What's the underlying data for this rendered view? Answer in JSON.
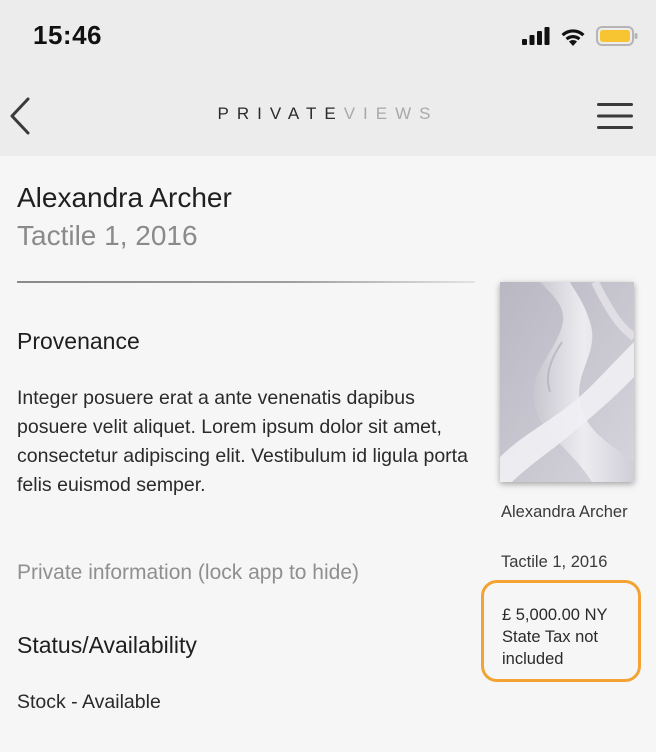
{
  "status_bar": {
    "time": "15:46",
    "icons": [
      "signal-icon",
      "wifi-icon",
      "battery-icon"
    ],
    "battery_color": "#f7c531"
  },
  "nav": {
    "back_icon": "chevron-left-icon",
    "logo_part1": "PRIVATE",
    "logo_part2": "VIEWS",
    "menu_icon": "hamburger-menu-icon"
  },
  "artwork": {
    "artist": "Alexandra Archer",
    "title": "Tactile 1, 2016",
    "provenance_heading": "Provenance",
    "provenance_text": "Integer posuere erat a ante venenatis dapibus posuere velit aliquet. Lorem ipsum dolor sit amet, consectetur adipiscing elit. Vestibulum id ligula porta felis euismod semper.",
    "private_info": "Private information (lock app to hide)",
    "status_heading": "Status/Availability",
    "status_value": "Stock - Available"
  },
  "sidebar": {
    "caption_artist": "Alexandra Archer",
    "caption_title": "Tactile 1, 2016",
    "price": "£ 5,000.00 NY State Tax not included",
    "highlight_color": "#f3a332"
  }
}
